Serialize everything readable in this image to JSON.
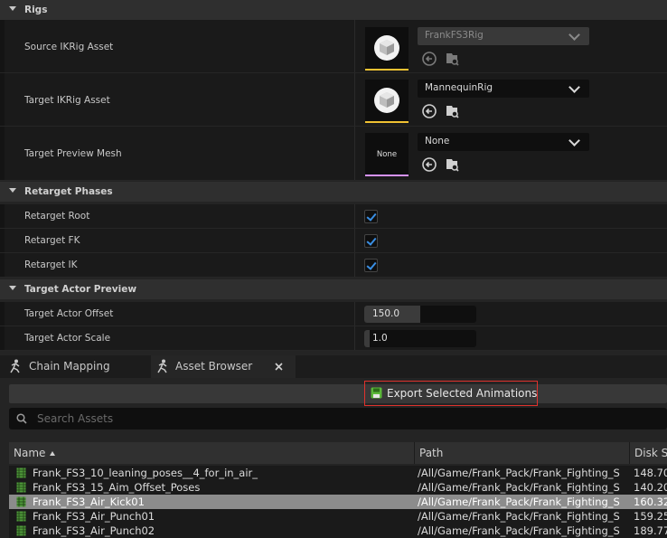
{
  "rigs": {
    "header": "Rigs",
    "source": {
      "label": "Source IKRig Asset",
      "value": "FrankFS3Rig"
    },
    "target": {
      "label": "Target IKRig Asset",
      "value": "MannequinRig"
    },
    "preview_mesh": {
      "label": "Target Preview Mesh",
      "value": "None",
      "thumb_text": "None"
    }
  },
  "phases": {
    "header": "Retarget Phases",
    "items": [
      {
        "label": "Retarget Root",
        "checked": true
      },
      {
        "label": "Retarget FK",
        "checked": true
      },
      {
        "label": "Retarget IK",
        "checked": true
      }
    ]
  },
  "actor_preview": {
    "header": "Target Actor Preview",
    "offset": {
      "label": "Target Actor Offset",
      "value": "150.0",
      "slider_fraction": 0.5
    },
    "scale": {
      "label": "Target Actor Scale",
      "value": "1.0",
      "slider_fraction": 0.05
    }
  },
  "tabs": [
    {
      "label": "Chain Mapping",
      "active": false
    },
    {
      "label": "Asset Browser",
      "active": true
    }
  ],
  "asset_browser": {
    "export_label": "Export Selected Animations",
    "search_placeholder": "Search Assets",
    "columns": [
      "Name",
      "Path",
      "Disk S"
    ],
    "rows": [
      {
        "name": "Frank_FS3_10_leaning_poses__4_for_in_air_",
        "path": "/All/Game/Frank_Pack/Frank_Fighting_S",
        "size": "148.70",
        "selected": false
      },
      {
        "name": "Frank_FS3_15_Aim_Offset_Poses",
        "path": "/All/Game/Frank_Pack/Frank_Fighting_S",
        "size": "140.20",
        "selected": false
      },
      {
        "name": "Frank_FS3_Air_Kick01",
        "path": "/All/Game/Frank_Pack/Frank_Fighting_S",
        "size": "160.32",
        "selected": true
      },
      {
        "name": "Frank_FS3_Air_Punch01",
        "path": "/All/Game/Frank_Pack/Frank_Fighting_S",
        "size": "159.25",
        "selected": false
      },
      {
        "name": "Frank_FS3_Air_Punch02",
        "path": "/All/Game/Frank_Pack/Frank_Fighting_S",
        "size": "189.77",
        "selected": false
      }
    ]
  },
  "colors": {
    "accent_check": "#3a8fe4",
    "ikrig_thumb_border": "#f1c232",
    "mesh_thumb_border": "#d692ff",
    "export_highlight": "#e0322d",
    "save_icon": "#5bb83a"
  },
  "icons": [
    "browse-back-icon",
    "find-in-browser-icon",
    "retarget-pose-icon",
    "save-icon",
    "search-icon",
    "animation-sequence-icon",
    "close-icon"
  ]
}
